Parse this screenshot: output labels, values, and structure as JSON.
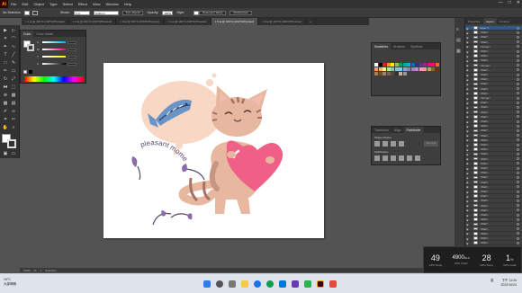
{
  "app": {
    "logo": "Ai"
  },
  "menubar": {
    "items": [
      "File",
      "Edit",
      "Object",
      "Type",
      "Select",
      "Effect",
      "View",
      "Window",
      "Help"
    ],
    "controls": [
      "—",
      "□",
      "✕"
    ]
  },
  "controlbar": {
    "selection_label": "No Selection",
    "stroke_label": "Stroke:",
    "stroke_value": "1 pt",
    "profile_label": "Uniform",
    "brush_label": "5 pt. Round",
    "opacity_label": "Opacity:",
    "opacity_value": "100%",
    "style_label": "Style:",
    "doc_setup": "Document Setup",
    "prefs": "Preferences"
  },
  "doctabs": [
    {
      "label": "× 1.ai @ 100 % (CMYK/Preview)",
      "active": false
    },
    {
      "label": "× 2.ai @ 100 % (CMYK/Preview)",
      "active": false
    },
    {
      "label": "× 3.ai @ 100 % (CMYK/Preview)",
      "active": false
    },
    {
      "label": "× 4.ai @ 100 % (CMYK/Preview)",
      "active": false
    },
    {
      "label": "× 5.ai @ 100 % (CMYK/Preview)",
      "active": true
    },
    {
      "label": "× 6.ai @ 100 % (CMYK/Preview)",
      "active": false
    },
    {
      "label": "»",
      "active": false
    }
  ],
  "color_panel": {
    "tabs": [
      "Color",
      "Color Guide"
    ],
    "sliders": [
      "C",
      "M",
      "Y",
      "K"
    ]
  },
  "swatches_panel": {
    "tabs": [
      "Swatches",
      "Brushes",
      "Symbols"
    ]
  },
  "pathfinder_panel": {
    "tabs": [
      "Transform",
      "Align",
      "Pathfinder"
    ],
    "shape_modes_label": "Shape Modes:",
    "pathfinders_label": "Pathfinders:",
    "expand_label": "Expand"
  },
  "layers_panel": {
    "tabs": [
      "Properties",
      "Layers",
      "Libraries"
    ],
    "layers": [
      "Layer 1",
      "<Path>",
      "<Path>",
      "<Path>",
      "<Group>",
      "<Path>",
      "<Path>",
      "<Path>",
      "<Group>",
      "<Path>",
      "<Path>",
      "<Path>",
      "<Path>",
      "<Path>",
      "<Path>",
      "<Group>",
      "<Path>",
      "<Path>",
      "<Path>",
      "<Path>",
      "<Path>",
      "<Path>",
      "<Path>",
      "<Path>",
      "<Path>",
      "<Path>",
      "<Path>",
      "<Path>",
      "<Path>",
      "<Path>",
      "<Path>",
      "<Path>",
      "<Path>",
      "<Path>",
      "<Path>",
      "<Path>",
      "<Path>",
      "<Path>",
      "<Path>",
      "<Path>",
      "<Path>",
      "<Path>",
      "<Path>",
      "<Path>",
      "<Path>",
      "<Path>",
      "<Path>",
      "<Path>",
      "<Path>"
    ],
    "footer": "1 Layer"
  },
  "artwork": {
    "text": "pleasant moment"
  },
  "statusbar": {
    "zoom": "100%",
    "rotate": "0°",
    "page": "1",
    "tool": "Selection"
  },
  "gpu": [
    {
      "value": "49",
      "label": "CPU Temp"
    },
    {
      "value": "4900",
      "unit": "MHz",
      "label": "CPU Clock"
    },
    {
      "value": "28",
      "label": "GPU Temp"
    },
    {
      "value": "1",
      "unit": "%",
      "label": "GPU Load"
    }
  ],
  "taskbar": {
    "weather_temp": "19°C",
    "weather_text": "大部晴朗",
    "time": "下午 11:34",
    "date": "2022/10/24",
    "ime": "英"
  },
  "colors": {
    "accent": "#ff9a00",
    "artboard": "#ffffff",
    "cat": "#e7b89f",
    "heart": "#ef5f86",
    "bubble": "#f8d7c5",
    "fish": "#5a84b8"
  }
}
